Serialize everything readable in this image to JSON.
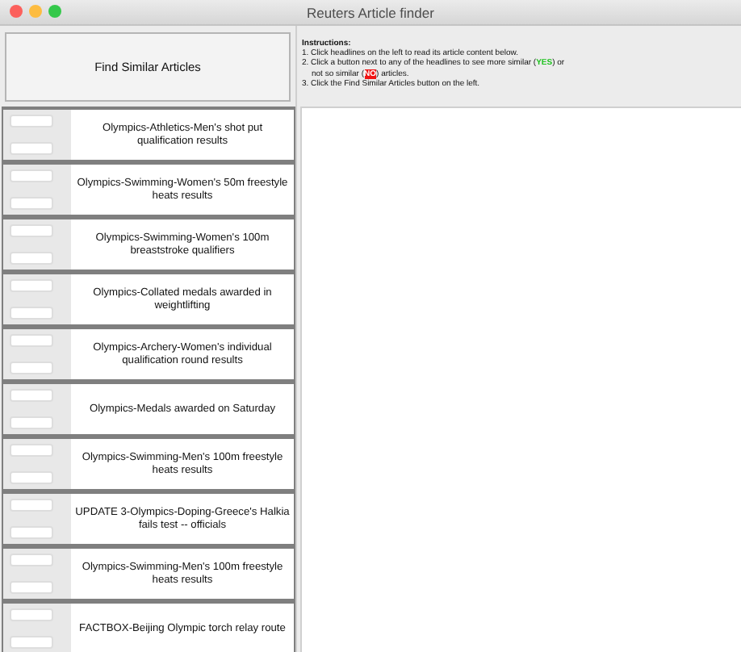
{
  "window": {
    "title": "Reuters Article finder"
  },
  "find_button": {
    "label": "Find Similar Articles"
  },
  "instructions": {
    "heading": "Instructions:",
    "steps": [
      {
        "segments": [
          {
            "kind": "plain",
            "text": "1. Click headlines on the left to read its article content below."
          }
        ]
      },
      {
        "segments": [
          {
            "kind": "plain",
            "text": "2. Click a button next to any of the headlines to see more similar ("
          },
          {
            "kind": "yes",
            "text": "YES"
          },
          {
            "kind": "plain",
            "text": ") or"
          }
        ]
      },
      {
        "segments": [
          {
            "kind": "indent",
            "text": "not so similar ("
          },
          {
            "kind": "no",
            "text": "NO"
          },
          {
            "kind": "plain",
            "text": ") articles."
          }
        ]
      },
      {
        "segments": [
          {
            "kind": "plain",
            "text": "3. Click the Find Similar Articles button on the left."
          }
        ]
      }
    ]
  },
  "articles": [
    {
      "headline": "Olympics-Athletics-Men's shot put qualification results"
    },
    {
      "headline": "Olympics-Swimming-Women's 50m freestyle heats results"
    },
    {
      "headline": "Olympics-Swimming-Women's 100m breaststroke qualifiers"
    },
    {
      "headline": "Olympics-Collated medals awarded in weightlifting"
    },
    {
      "headline": "Olympics-Archery-Women's individual qualification round results"
    },
    {
      "headline": "Olympics-Medals awarded on Saturday"
    },
    {
      "headline": "Olympics-Swimming-Men's 100m freestyle heats results"
    },
    {
      "headline": "UPDATE 3-Olympics-Doping-Greece's Halkia fails test -- officials"
    },
    {
      "headline": "Olympics-Swimming-Men's 100m freestyle heats results"
    },
    {
      "headline": "FACTBOX-Beijing Olympic torch relay route"
    }
  ]
}
